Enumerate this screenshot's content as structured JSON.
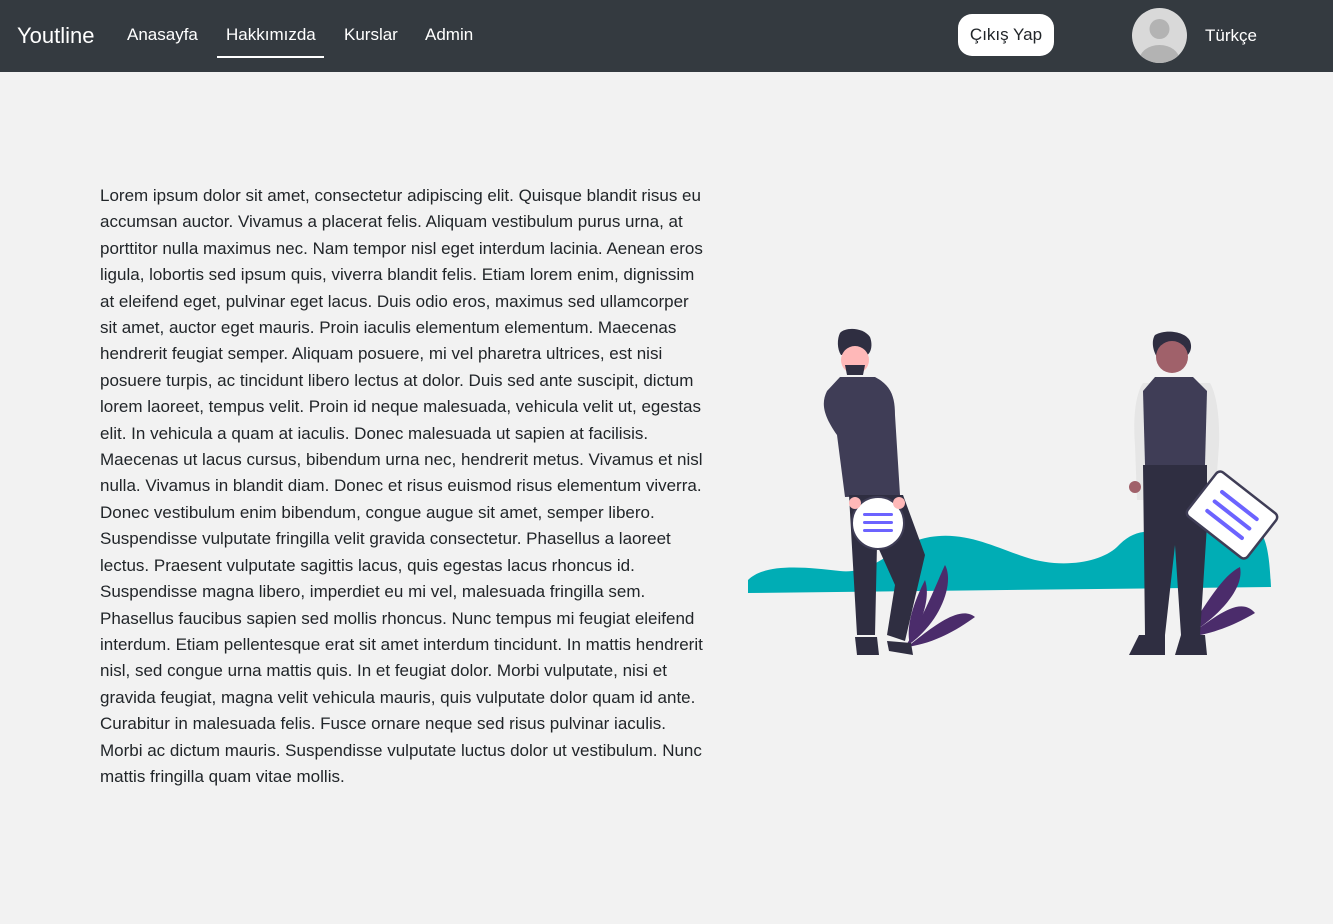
{
  "nav": {
    "brand": "Youtline",
    "links": [
      {
        "label": "Anasayfa",
        "active": false
      },
      {
        "label": "Hakkımızda",
        "active": true
      },
      {
        "label": "Kurslar",
        "active": false
      },
      {
        "label": "Admin",
        "active": false
      }
    ],
    "logout_label": "Çıkış Yap",
    "language": "Türkçe"
  },
  "main": {
    "paragraph": "Lorem ipsum dolor sit amet, consectetur adipiscing elit. Quisque blandit risus eu accumsan auctor. Vivamus a placerat felis. Aliquam vestibulum purus urna, at porttitor nulla maximus nec. Nam tempor nisl eget interdum lacinia. Aenean eros ligula, lobortis sed ipsum quis, viverra blandit felis. Etiam lorem enim, dignissim at eleifend eget, pulvinar eget lacus. Duis odio eros, maximus sed ullamcorper sit amet, auctor eget mauris. Proin iaculis elementum elementum. Maecenas hendrerit feugiat semper. Aliquam posuere, mi vel pharetra ultrices, est nisi posuere turpis, ac tincidunt libero lectus at dolor. Duis sed ante suscipit, dictum lorem laoreet, tempus velit. Proin id neque malesuada, vehicula velit ut, egestas elit. In vehicula a quam at iaculis. Donec malesuada ut sapien at facilisis. Maecenas ut lacus cursus, bibendum urna nec, hendrerit metus. Vivamus et nisl nulla. Vivamus in blandit diam. Donec et risus euismod risus elementum viverra. Donec vestibulum enim bibendum, congue augue sit amet, semper libero. Suspendisse vulputate fringilla velit gravida consectetur. Phasellus a laoreet lectus. Praesent vulputate sagittis lacus, quis egestas lacus rhoncus id. Suspendisse magna libero, imperdiet eu mi vel, malesuada fringilla sem. Phasellus faucibus sapien sed mollis rhoncus. Nunc tempus mi feugiat eleifend interdum. Etiam pellentesque erat sit amet interdum tincidunt. In mattis hendrerit nisl, sed congue urna mattis quis. In et feugiat dolor. Morbi vulputate, nisi et gravida feugiat, magna velit vehicula mauris, quis vulputate dolor quam id ante. Curabitur in malesuada felis. Fusce ornare neque sed risus pulvinar iaculis. Morbi ac dictum mauris. Suspendisse vulputate luctus dolor ut vestibulum. Nunc mattis fringilla quam vitae mollis."
  },
  "colors": {
    "navbar": "#343a40",
    "page_background": "#f2f2f2",
    "accent_teal": "#00adb5",
    "accent_purple": "#6c63ff",
    "plant_purple": "#4b2c6b",
    "clothing_dark": "#3f3d56",
    "pants_dark": "#2f2e41"
  },
  "icons": {
    "avatar": "user-avatar-icon"
  }
}
